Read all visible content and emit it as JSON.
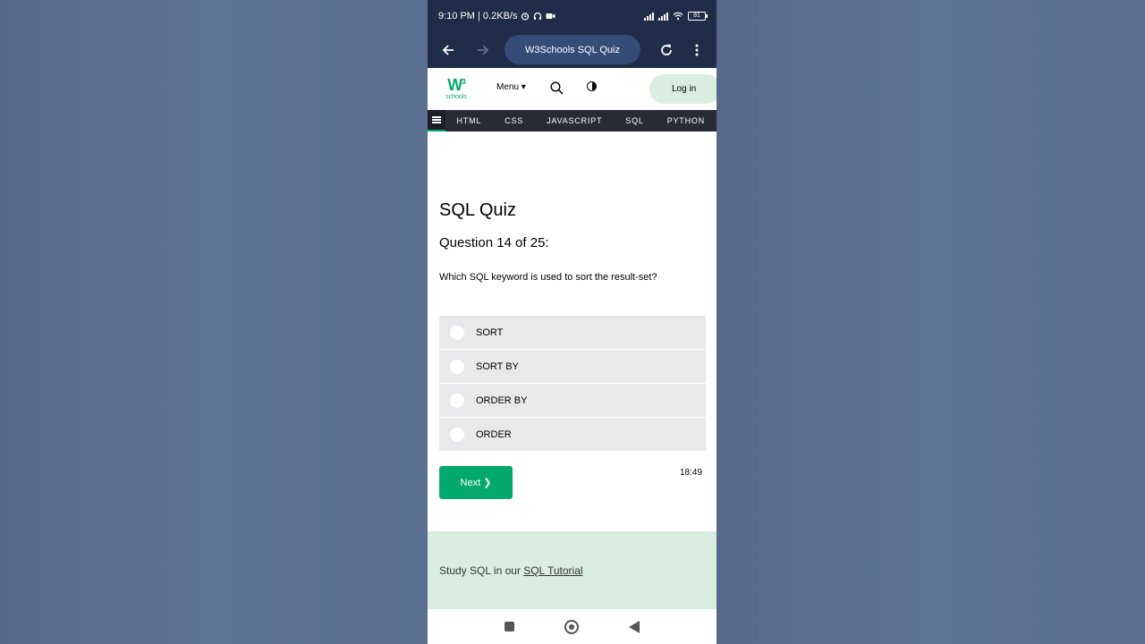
{
  "status": {
    "time": "9:10 PM | 0.2KB/s",
    "battery": "81"
  },
  "browser": {
    "url_title": "W3Schools SQL Quiz"
  },
  "header": {
    "logo_main": "W",
    "logo_sup": "3",
    "logo_sub": "schools",
    "menu_label": "Menu ▾",
    "login_label": "Log in"
  },
  "topnav": {
    "items": [
      "HTML",
      "CSS",
      "JAVASCRIPT",
      "SQL",
      "PYTHON"
    ]
  },
  "quiz": {
    "title": "SQL Quiz",
    "progress": "Question 14 of 25:",
    "question": "Which SQL keyword is used to sort the result-set?",
    "options": [
      "SORT",
      "SORT BY",
      "ORDER BY",
      "ORDER"
    ],
    "next_label": "Next ❯",
    "timer": "18:49"
  },
  "study": {
    "prefix": "Study SQL in our ",
    "link": "SQL Tutorial"
  },
  "colors": {
    "brand_green": "#04aa6d",
    "browser_bar": "#1f2d48",
    "panel_green": "#d9eee1"
  }
}
